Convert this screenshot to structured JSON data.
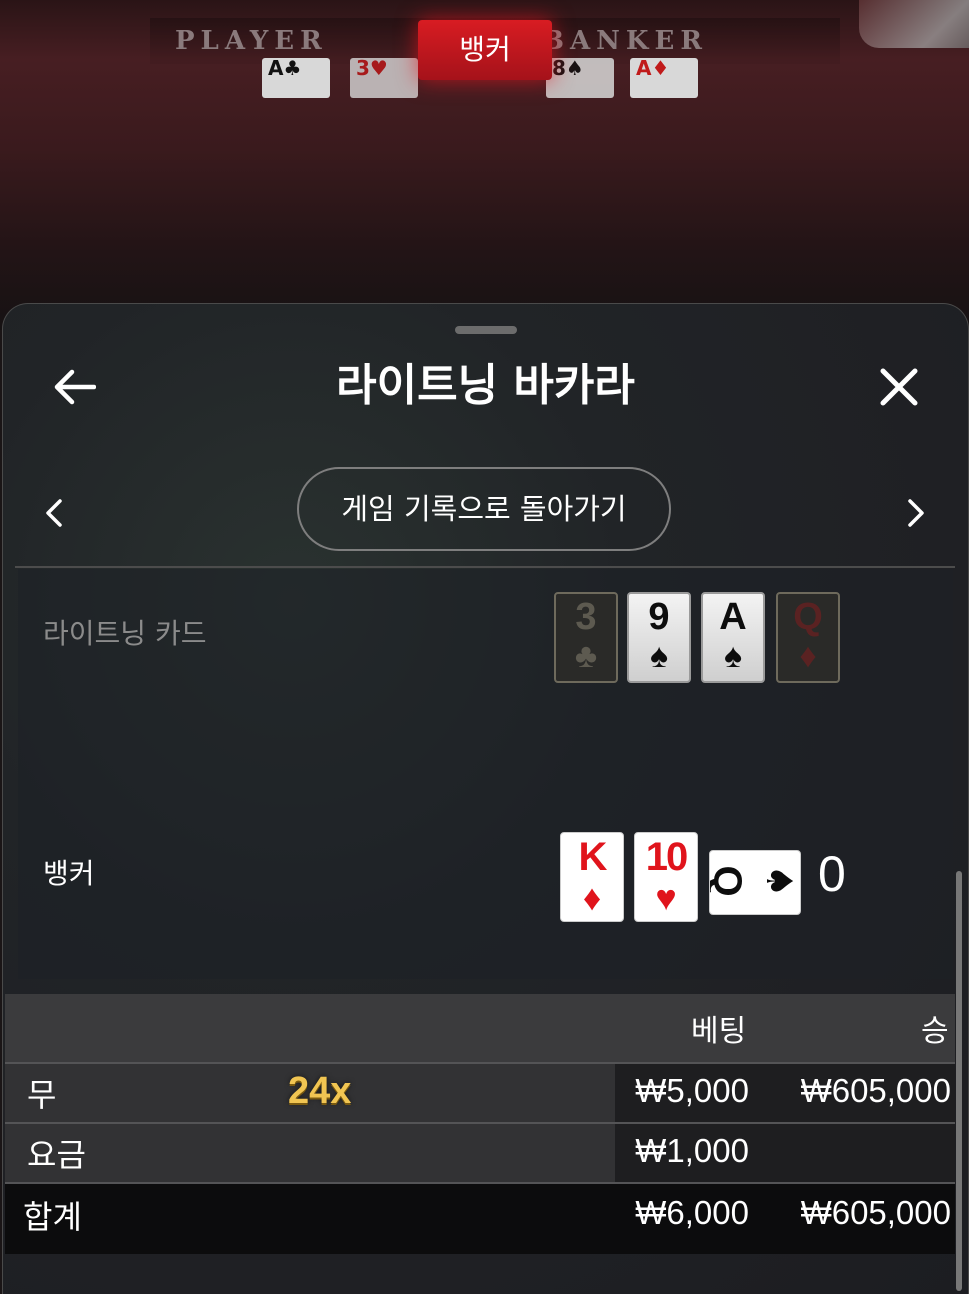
{
  "table": {
    "player_word": "PLAYER",
    "banker_word": "BANKER",
    "winner_badge": "뱅커",
    "cards": [
      {
        "rank": "A",
        "suit": "♣"
      },
      {
        "rank": "3",
        "suit": "♥"
      },
      {
        "rank": "8",
        "suit": "♠"
      },
      {
        "rank": "A",
        "suit": "♦"
      }
    ]
  },
  "sheet": {
    "title": "라이트닝 바카라",
    "back_icon": "arrow-left-icon",
    "close_icon": "close-icon",
    "history_button": "게임 기록으로 돌아가기",
    "prev_icon": "chevron-left-icon",
    "next_icon": "chevron-right-icon"
  },
  "lightning": {
    "label": "라이트닝 카드",
    "cards": [
      {
        "rank": "3",
        "suit": "♣",
        "lit": false
      },
      {
        "rank": "9",
        "suit": "♠",
        "lit": true
      },
      {
        "rank": "A",
        "suit": "♠",
        "lit": true
      },
      {
        "rank": "Q",
        "suit": "♦",
        "lit": false
      }
    ]
  },
  "banker": {
    "label": "뱅커",
    "cards": [
      {
        "rank": "K",
        "suit": "♦"
      },
      {
        "rank": "10",
        "suit": "♥"
      },
      {
        "rank": "Q",
        "suit": "♠"
      }
    ],
    "score": "0"
  },
  "bets": {
    "headers": {
      "bet": "베팅",
      "win": "승"
    },
    "rows": [
      {
        "label": "무",
        "multiplier": "24x",
        "bet": "₩5,000",
        "win": "₩605,000"
      },
      {
        "label": "요금",
        "bet": "₩1,000",
        "win": ""
      }
    ],
    "total": {
      "label": "합계",
      "bet": "₩6,000",
      "win": "₩605,000"
    }
  },
  "colors": {
    "accent_red": "#d81c22",
    "multiplier_gold": "#f1c552"
  }
}
